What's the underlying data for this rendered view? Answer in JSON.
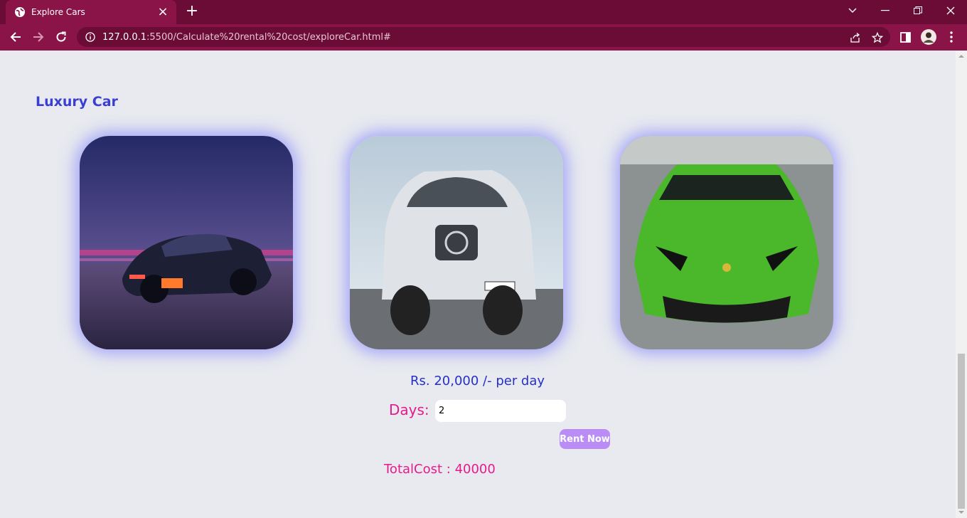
{
  "browser": {
    "tab_title": "Explore Cars",
    "url_host": "127.0.0.1",
    "url_path": ":5500/Calculate%20rental%20cost/exploreCar.html#",
    "theme_color": "#8a1448",
    "tab_strip_color": "#6a0c36"
  },
  "page": {
    "section_title": "Luxury Car",
    "cars": [
      {
        "name": "dark-supercar",
        "icon": "car-image"
      },
      {
        "name": "white-suv",
        "icon": "car-image"
      },
      {
        "name": "green-supercar",
        "icon": "car-image"
      }
    ],
    "price_text": "Rs. 20,000 /- per day",
    "days_label": "Days:",
    "days_value": "2",
    "rent_button": "Rent Now",
    "total_cost": "TotalCost : 40000",
    "colors": {
      "title": "#3a3fd4",
      "price": "#2630c8",
      "accent_pink": "#e61b8c",
      "button": "#b98df5"
    }
  }
}
